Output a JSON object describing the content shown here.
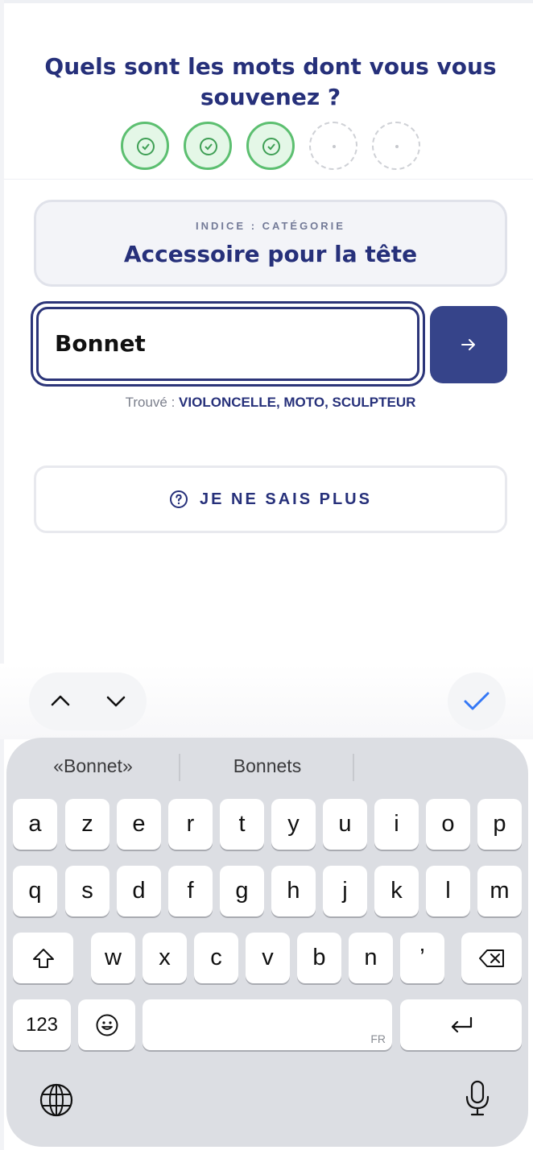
{
  "question": "Quels sont les mots dont vous vous souvenez ?",
  "progress": {
    "completed": 3,
    "total": 5
  },
  "hint": {
    "label": "INDICE : CATÉGORIE",
    "text": "Accessoire pour la tête"
  },
  "answer_input": {
    "value": "Bonnet"
  },
  "found": {
    "label": "Trouvé :",
    "words": "VIOLONCELLE, MOTO, SCULPTEUR"
  },
  "dunno_button": {
    "label": "JE NE SAIS PLUS"
  },
  "icons": {
    "submit": "arrow-right-icon",
    "help": "question-circle-icon",
    "check": "check-icon"
  },
  "keyboard": {
    "suggestions": [
      "«Bonnet»",
      "Bonnets"
    ],
    "row1": [
      "a",
      "z",
      "e",
      "r",
      "t",
      "y",
      "u",
      "i",
      "o",
      "p"
    ],
    "row2": [
      "q",
      "s",
      "d",
      "f",
      "g",
      "h",
      "j",
      "k",
      "l",
      "m"
    ],
    "row3": [
      "w",
      "x",
      "c",
      "v",
      "b",
      "n",
      "’"
    ],
    "numbers_key": "123",
    "language_tag": "FR"
  },
  "colors": {
    "primary": "#26307a",
    "accent": "#36448a",
    "success": "#5cbf70"
  }
}
